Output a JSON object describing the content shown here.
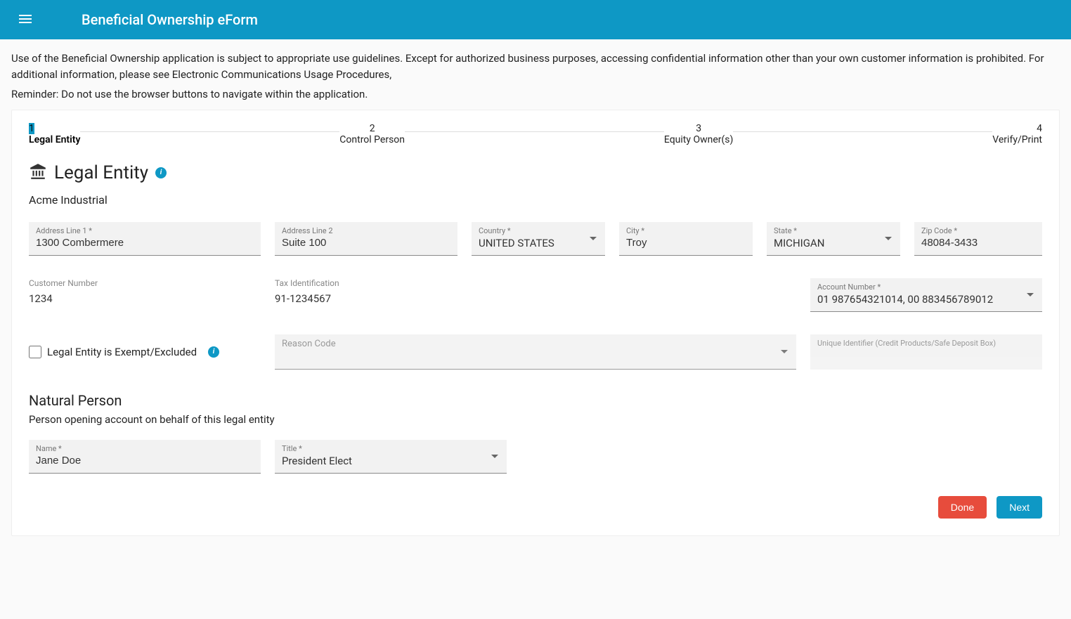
{
  "header": {
    "title": "Beneficial Ownership eForm"
  },
  "disclaimer": {
    "line1_a": "Use of the Beneficial Ownership application is subject to ",
    "line1_b": " appropriate use guidelines. Except for authorized business purposes, accessing confidential information other than your own customer information is prohibited. For additional information, please see ",
    "line1_c": " Electronic Communications Usage Procedures,",
    "line2": "Reminder: Do not use the browser buttons to navigate within the application."
  },
  "stepper": {
    "steps": [
      {
        "num": "1",
        "label": "Legal Entity",
        "active": true
      },
      {
        "num": "2",
        "label": "Control Person",
        "active": false
      },
      {
        "num": "3",
        "label": "Equity Owner(s)",
        "active": false
      },
      {
        "num": "4",
        "label": "Verify/Print",
        "active": false
      }
    ]
  },
  "legalEntity": {
    "heading": "Legal Entity",
    "infoTip": "i",
    "entityName": "Acme Industrial",
    "address1": {
      "label": "Address Line 1 *",
      "value": "1300 Combermere"
    },
    "address2": {
      "label": "Address Line 2",
      "value": "Suite 100"
    },
    "country": {
      "label": "Country *",
      "value": "UNITED STATES"
    },
    "city": {
      "label": "City *",
      "value": "Troy"
    },
    "state": {
      "label": "State *",
      "value": "MICHIGAN"
    },
    "zip": {
      "label": "Zip Code *",
      "value": "48084-3433"
    },
    "customerNumber": {
      "label": "Customer Number",
      "value": "1234"
    },
    "taxId": {
      "label": "Tax Identification",
      "value": "91-1234567"
    },
    "accountNumber": {
      "label": "Account Number *",
      "value": "01 987654321014, 00 883456789012"
    },
    "exemptLabel": "Legal Entity is Exempt/Excluded",
    "exemptInfoTip": "i",
    "reasonCode": {
      "label": "Reason Code",
      "value": ""
    },
    "uniqueId": {
      "label": "Unique Identifier (Credit Products/Safe Deposit Box)",
      "value": ""
    }
  },
  "naturalPerson": {
    "heading": "Natural Person",
    "subtext": "Person opening account on behalf of this legal entity",
    "name": {
      "label": "Name *",
      "value": "Jane Doe"
    },
    "title": {
      "label": "Title *",
      "value": "President Elect"
    }
  },
  "actions": {
    "done": "Done",
    "next": "Next"
  }
}
